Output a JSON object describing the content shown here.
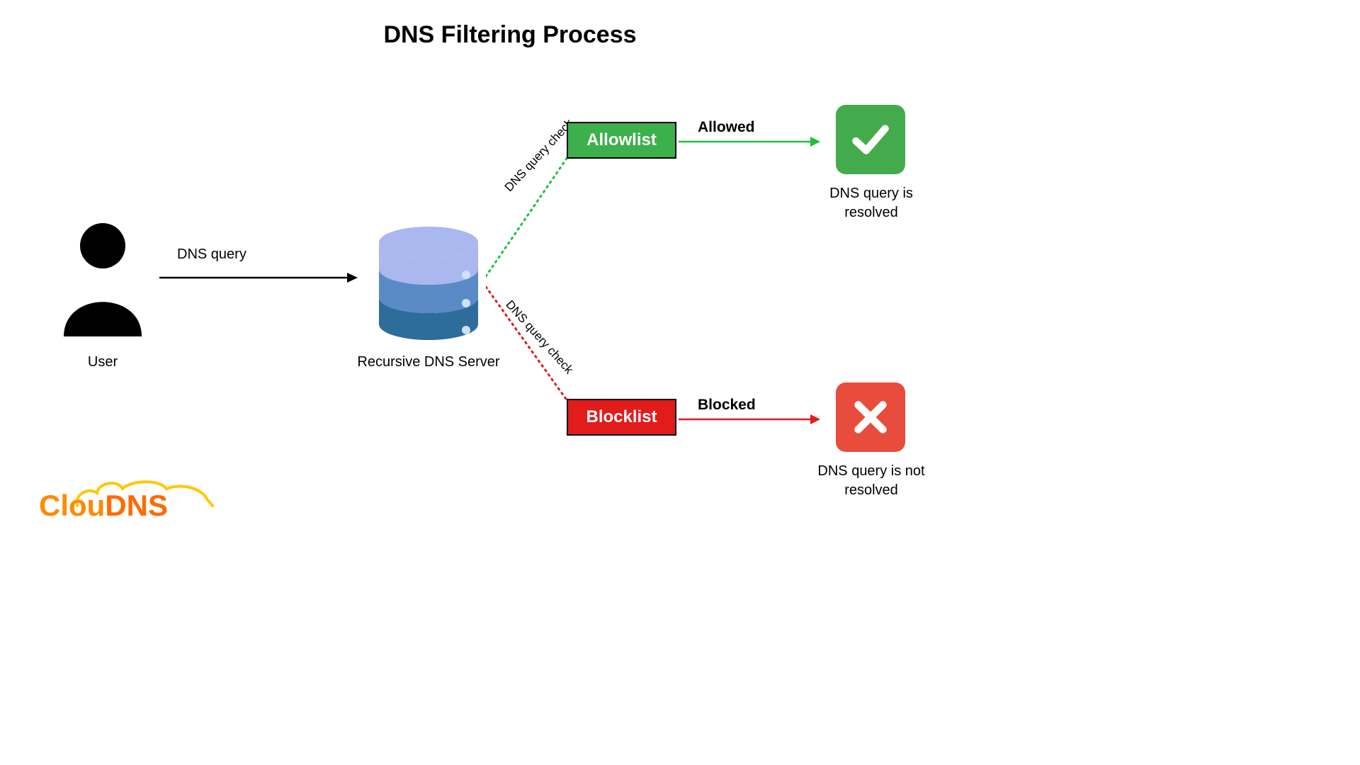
{
  "title": "DNS Filtering Process",
  "user": {
    "label": "User"
  },
  "query": {
    "label": "DNS query"
  },
  "server": {
    "label": "Recursive DNS Server"
  },
  "check": {
    "topLabel": "DNS query check",
    "bottomLabel": "DNS query check"
  },
  "allowlist": {
    "box": "Allowlist",
    "arrowLabel": "Allowed"
  },
  "blocklist": {
    "box": "Blocklist",
    "arrowLabel": "Blocked"
  },
  "result": {
    "resolved": "DNS query is resolved",
    "notResolved": "DNS query is not resolved"
  },
  "logo": {
    "part1": "Clou",
    "part2": "DNS"
  },
  "colors": {
    "green": "#3bb04b",
    "red": "#e21b1b",
    "badgeGreen": "#44ab4d",
    "badgeRed": "#e74c3c",
    "orange1": "#ff8a00",
    "orange2": "#ff6a00",
    "yellow": "#ffc800",
    "serverLight": "#aab8ef",
    "serverMid": "#5a8bc7",
    "serverDark": "#2e6d9b"
  }
}
